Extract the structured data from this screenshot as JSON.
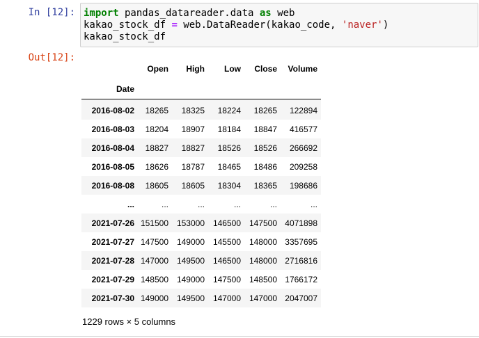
{
  "cell": {
    "in_prompt": "In [12]:",
    "out_prompt": "Out[12]:",
    "code": {
      "line1": {
        "kw1": "import",
        "mid": " pandas_datareader.data ",
        "kw2": "as",
        "end": " web"
      },
      "line2": {
        "lhs": "kakao_stock_df ",
        "op": "=",
        "call": " web.DataReader(kakao_code, ",
        "str": "'naver'",
        "close": ")"
      },
      "line3": "kakao_stock_df"
    }
  },
  "dataframe": {
    "columns": [
      "Open",
      "High",
      "Low",
      "Close",
      "Volume"
    ],
    "index_name": "Date",
    "rows": [
      [
        "2016-08-02",
        "18265",
        "18325",
        "18224",
        "18265",
        "122894"
      ],
      [
        "2016-08-03",
        "18204",
        "18907",
        "18184",
        "18847",
        "416577"
      ],
      [
        "2016-08-04",
        "18827",
        "18827",
        "18526",
        "18526",
        "266692"
      ],
      [
        "2016-08-05",
        "18626",
        "18787",
        "18465",
        "18486",
        "209258"
      ],
      [
        "2016-08-08",
        "18605",
        "18605",
        "18304",
        "18365",
        "198686"
      ],
      [
        "...",
        "...",
        "...",
        "...",
        "...",
        "..."
      ],
      [
        "2021-07-26",
        "151500",
        "153000",
        "146500",
        "147500",
        "4071898"
      ],
      [
        "2021-07-27",
        "147500",
        "149000",
        "145500",
        "148000",
        "3357695"
      ],
      [
        "2021-07-28",
        "147000",
        "149500",
        "146500",
        "148000",
        "2716816"
      ],
      [
        "2021-07-29",
        "148500",
        "149000",
        "147500",
        "148500",
        "1766172"
      ],
      [
        "2021-07-30",
        "149000",
        "149500",
        "147000",
        "147000",
        "2047007"
      ]
    ],
    "shape_text": "1229 rows × 5 columns"
  }
}
